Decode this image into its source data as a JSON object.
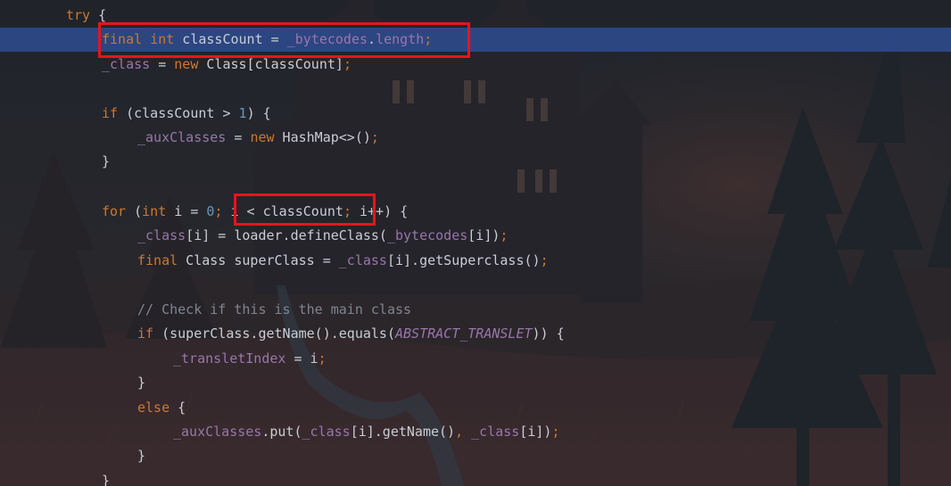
{
  "code_lines": [
    {
      "tokens": [
        {
          "t": "kw",
          "v": "try"
        },
        {
          "t": "plain",
          "v": " {"
        }
      ]
    },
    {
      "tokens": [
        {
          "t": "kw",
          "v": "final"
        },
        {
          "t": "plain",
          "v": " "
        },
        {
          "t": "kw",
          "v": "int"
        },
        {
          "t": "plain",
          "v": " classCount = "
        },
        {
          "t": "fld",
          "v": "_bytecodes"
        },
        {
          "t": "plain",
          "v": "."
        },
        {
          "t": "fld",
          "v": "length"
        },
        {
          "t": "kw",
          "v": ";"
        }
      ]
    },
    {
      "tokens": [
        {
          "t": "fld",
          "v": "_class"
        },
        {
          "t": "plain",
          "v": " = "
        },
        {
          "t": "kw",
          "v": "new"
        },
        {
          "t": "plain",
          "v": " Class[classCount]"
        },
        {
          "t": "kw",
          "v": ";"
        }
      ]
    },
    {
      "tokens": []
    },
    {
      "tokens": [
        {
          "t": "kw",
          "v": "if"
        },
        {
          "t": "plain",
          "v": " (classCount > "
        },
        {
          "t": "num",
          "v": "1"
        },
        {
          "t": "plain",
          "v": ") {"
        }
      ]
    },
    {
      "tokens": [
        {
          "t": "fld",
          "v": "_auxClasses"
        },
        {
          "t": "plain",
          "v": " = "
        },
        {
          "t": "kw",
          "v": "new"
        },
        {
          "t": "plain",
          "v": " HashMap<>()"
        },
        {
          "t": "kw",
          "v": ";"
        }
      ]
    },
    {
      "tokens": [
        {
          "t": "plain",
          "v": "}"
        }
      ]
    },
    {
      "tokens": []
    },
    {
      "tokens": [
        {
          "t": "kw",
          "v": "for"
        },
        {
          "t": "plain",
          "v": " ("
        },
        {
          "t": "kw",
          "v": "int"
        },
        {
          "t": "plain",
          "v": " i = "
        },
        {
          "t": "num",
          "v": "0"
        },
        {
          "t": "kw",
          "v": ";"
        },
        {
          "t": "plain",
          "v": " i < classCount"
        },
        {
          "t": "kw",
          "v": ";"
        },
        {
          "t": "plain",
          "v": " i++) {"
        }
      ]
    },
    {
      "tokens": [
        {
          "t": "fld",
          "v": "_class"
        },
        {
          "t": "plain",
          "v": "[i] = loader.defineClass("
        },
        {
          "t": "fld",
          "v": "_bytecodes"
        },
        {
          "t": "plain",
          "v": "[i])"
        },
        {
          "t": "kw",
          "v": ";"
        }
      ]
    },
    {
      "tokens": [
        {
          "t": "kw",
          "v": "final"
        },
        {
          "t": "plain",
          "v": " Class superClass = "
        },
        {
          "t": "fld",
          "v": "_class"
        },
        {
          "t": "plain",
          "v": "[i].getSuperclass()"
        },
        {
          "t": "kw",
          "v": ";"
        }
      ]
    },
    {
      "tokens": []
    },
    {
      "tokens": [
        {
          "t": "cmt",
          "v": "// Check if this is the main class"
        }
      ]
    },
    {
      "tokens": [
        {
          "t": "kw",
          "v": "if"
        },
        {
          "t": "plain",
          "v": " (superClass.getName().equals("
        },
        {
          "t": "const",
          "v": "ABSTRACT_TRANSLET"
        },
        {
          "t": "plain",
          "v": ")) {"
        }
      ]
    },
    {
      "tokens": [
        {
          "t": "fld",
          "v": "_transletIndex"
        },
        {
          "t": "plain",
          "v": " = i"
        },
        {
          "t": "kw",
          "v": ";"
        }
      ]
    },
    {
      "tokens": [
        {
          "t": "plain",
          "v": "}"
        }
      ]
    },
    {
      "tokens": [
        {
          "t": "kw",
          "v": "else"
        },
        {
          "t": "plain",
          "v": " {"
        }
      ]
    },
    {
      "tokens": [
        {
          "t": "fld",
          "v": "_auxClasses"
        },
        {
          "t": "plain",
          "v": ".put("
        },
        {
          "t": "fld",
          "v": "_class"
        },
        {
          "t": "plain",
          "v": "[i].getName()"
        },
        {
          "t": "kw",
          "v": ","
        },
        {
          "t": "plain",
          "v": " "
        },
        {
          "t": "fld",
          "v": "_class"
        },
        {
          "t": "plain",
          "v": "[i])"
        },
        {
          "t": "kw",
          "v": ";"
        }
      ]
    },
    {
      "tokens": [
        {
          "t": "plain",
          "v": "}"
        }
      ]
    },
    {
      "tokens": [
        {
          "t": "plain",
          "v": "}"
        }
      ]
    }
  ],
  "current_line_index": 1,
  "highlights": [
    {
      "line": 1,
      "text": "final int classCount = _bytecodes.length;"
    },
    {
      "line": 8,
      "text": "i < classCount"
    }
  ],
  "colors": {
    "keyword": "#cc7832",
    "field": "#9876aa",
    "number": "#6897bb",
    "comment": "#7f8590",
    "plain": "#c9cdd4",
    "current_line": "#2e4e96",
    "highlight_box": "#e8141b"
  },
  "background_theme": "dark-castle-forest"
}
